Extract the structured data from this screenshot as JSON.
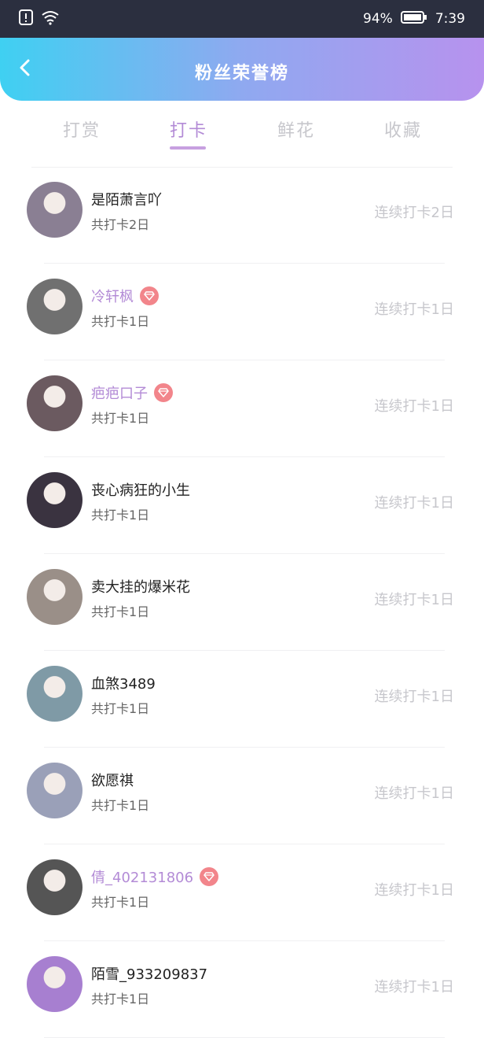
{
  "status_bar": {
    "battery": "94%",
    "time": "7:39",
    "icons": [
      "alert-icon",
      "wifi-icon",
      "battery-icon"
    ]
  },
  "header": {
    "title": "粉丝荣誉榜",
    "back_icon": "chevron-left-icon"
  },
  "tabs": [
    {
      "label": "打赏",
      "active": false
    },
    {
      "label": "打卡",
      "active": true
    },
    {
      "label": "鲜花",
      "active": false
    },
    {
      "label": "收藏",
      "active": false
    }
  ],
  "colors": {
    "accent": "#b38bd6",
    "header_gradient": [
      "#3fd0f2",
      "#b792ee"
    ],
    "vip_badge": "#f2858b",
    "muted": "#c7c7cc"
  },
  "fans": [
    {
      "name": "是陌萧言吖",
      "total": "共打卡2日",
      "streak": "连续打卡2日",
      "vip": false,
      "avatar_color": "#8a7f93"
    },
    {
      "name": "冷轩枫",
      "total": "共打卡1日",
      "streak": "连续打卡1日",
      "vip": true,
      "avatar_color": "#707070"
    },
    {
      "name": "疤疤口子",
      "total": "共打卡1日",
      "streak": "连续打卡1日",
      "vip": true,
      "avatar_color": "#6b5a60"
    },
    {
      "name": "丧心病狂的小生",
      "total": "共打卡1日",
      "streak": "连续打卡1日",
      "vip": false,
      "avatar_color": "#3a3340"
    },
    {
      "name": "卖大挂的爆米花",
      "total": "共打卡1日",
      "streak": "连续打卡1日",
      "vip": false,
      "avatar_color": "#9a8f88"
    },
    {
      "name": "血煞3489",
      "total": "共打卡1日",
      "streak": "连续打卡1日",
      "vip": false,
      "avatar_color": "#7f9aa6"
    },
    {
      "name": "欲愿祺",
      "total": "共打卡1日",
      "streak": "连续打卡1日",
      "vip": false,
      "avatar_color": "#9aa0b8"
    },
    {
      "name": "倩_402131806",
      "total": "共打卡1日",
      "streak": "连续打卡1日",
      "vip": true,
      "avatar_color": "#555555"
    },
    {
      "name": "陌雪_933209837",
      "total": "共打卡1日",
      "streak": "连续打卡1日",
      "vip": false,
      "avatar_color": "#a77fd0"
    }
  ]
}
